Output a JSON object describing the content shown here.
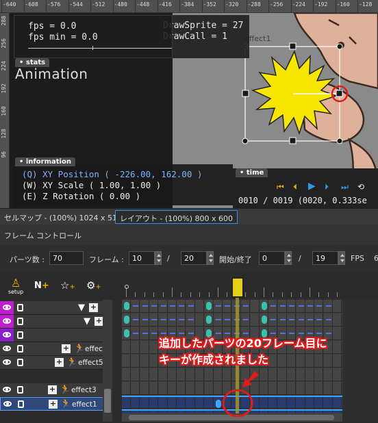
{
  "ruler": {
    "top_ticks": [
      "-640",
      "-608",
      "-576",
      "-544",
      "-512",
      "-480",
      "-448",
      "-416",
      "-384",
      "-352",
      "-320",
      "-288",
      "-256",
      "-224",
      "-192",
      "-160",
      "-128"
    ],
    "left_ticks": [
      "288",
      "256",
      "224",
      "192",
      "160",
      "128",
      "96"
    ]
  },
  "stats": {
    "tab": "stats",
    "fps": "fps = 0.0",
    "fps_min": "fps min = 0.0",
    "draw_sprite": "DrawSprite = 27",
    "draw_call": "DrawCall = 1"
  },
  "canvas": {
    "title": "Animation",
    "selected_part": "effect1"
  },
  "information": {
    "tab": "information",
    "xy_pos_prefix": "(Q) XY Position ",
    "xy_pos_value": "( -226.00, 162.00 )",
    "xy_scale": "(W) XY Scale ( 1.00, 1.00 )",
    "z_rot": "(E) Z Rotation ( 0.00 )"
  },
  "time": {
    "tab": "time",
    "readout": "0010 / 0019 (0020, 0.333se"
  },
  "tabs": [
    {
      "label": "セルマップ - (100%) 1024 x 512",
      "active": false
    },
    {
      "label": "レイアウト - (100%) 800 x 600",
      "active": true
    }
  ],
  "frame_control": {
    "title": "フレーム コントロール",
    "parts_label": "パーツ数 :",
    "parts_value": "70",
    "frame_label": "フレーム :",
    "frame_value": "10",
    "slash": "/",
    "frame_total": "20",
    "start_end_label": "開始/終了",
    "start_value": "0",
    "end_value": "19",
    "fps_label": "FPS",
    "fps_value": "6"
  },
  "toolbar": {
    "setup_label": "setup"
  },
  "layers": [
    {
      "name": "",
      "color": "#c21ccf"
    },
    {
      "name": "",
      "color": "#c21ccf"
    },
    {
      "name": "",
      "color": "#8a1fc9"
    },
    {
      "name": "effec",
      "color": "#3a3a3a"
    },
    {
      "name": "effect5",
      "color": "#3a3a3a"
    },
    {
      "name": "effect3",
      "color": "#3a3a3a"
    },
    {
      "name": "effect1",
      "color": "#3a3a3a"
    }
  ],
  "annotation": {
    "line1": "追加したパーツの20フレーム目に",
    "line2": "キーが作成されました",
    "color": "#e01b1b"
  }
}
